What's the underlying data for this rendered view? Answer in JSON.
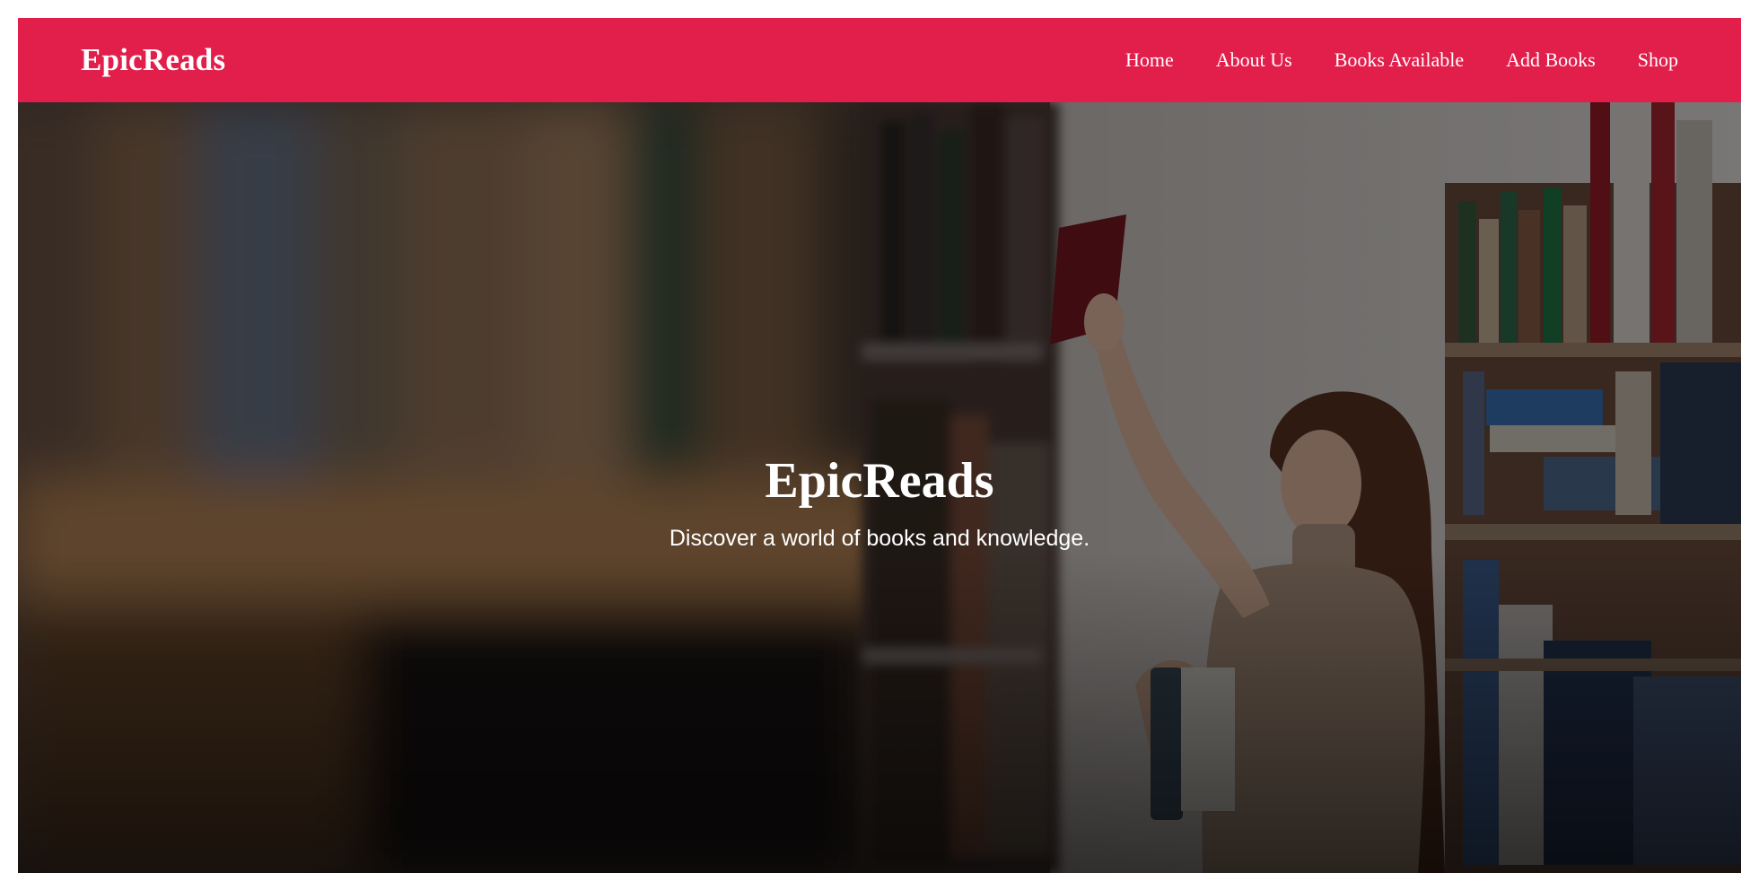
{
  "navbar": {
    "brand": "EpicReads",
    "links": [
      {
        "label": "Home"
      },
      {
        "label": "About Us"
      },
      {
        "label": "Books Available"
      },
      {
        "label": "Add Books"
      },
      {
        "label": "Shop"
      }
    ],
    "background_color": "#e21e4b"
  },
  "hero": {
    "title": "EpicReads",
    "subtitle": "Discover a world of books and knowledge.",
    "background_image": "library-shelves-woman-reaching-book-photo"
  }
}
